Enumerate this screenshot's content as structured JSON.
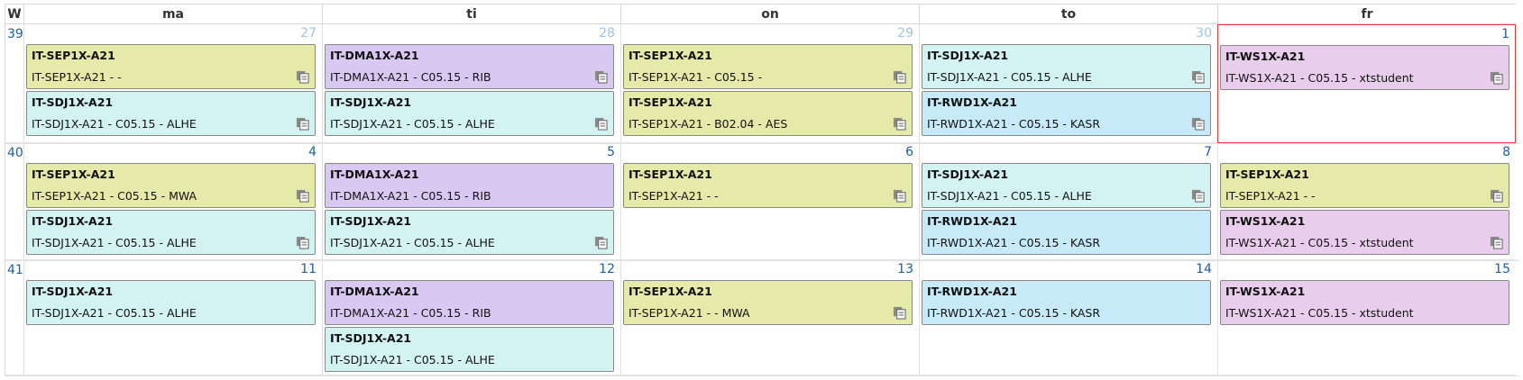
{
  "colors": {
    "SEP": "#e6eaa8",
    "SDJ": "#d3f3f3",
    "DMA": "#d8c8f2",
    "RWD": "#c6eaf8",
    "WS": "#e9cdec",
    "week_text": "#1f5fa0",
    "today_border": "#e8393b"
  },
  "header": {
    "week_label": "W",
    "days": [
      "ma",
      "ti",
      "on",
      "to",
      "fr"
    ]
  },
  "weeks": [
    {
      "number": "39",
      "days": [
        {
          "date": "27",
          "other_month": true,
          "events": [
            {
              "group": "SEP",
              "title": "IT-SEP1X-A21",
              "desc": "IT-SEP1X-A21 - -",
              "icon": true
            },
            {
              "group": "SDJ",
              "title": "IT-SDJ1X-A21",
              "desc": "IT-SDJ1X-A21 - C05.15 - ALHE",
              "icon": true
            }
          ]
        },
        {
          "date": "28",
          "other_month": true,
          "events": [
            {
              "group": "DMA",
              "title": "IT-DMA1X-A21",
              "desc": "IT-DMA1X-A21 - C05.15 - RIB",
              "icon": true
            },
            {
              "group": "SDJ",
              "title": "IT-SDJ1X-A21",
              "desc": "IT-SDJ1X-A21 - C05.15 - ALHE",
              "icon": true
            }
          ]
        },
        {
          "date": "29",
          "other_month": true,
          "events": [
            {
              "group": "SEP",
              "title": "IT-SEP1X-A21",
              "desc": "IT-SEP1X-A21 - C05.15 -",
              "icon": true
            },
            {
              "group": "SEP",
              "title": "IT-SEP1X-A21",
              "desc": "IT-SEP1X-A21 - B02.04 - AES",
              "icon": true
            }
          ]
        },
        {
          "date": "30",
          "other_month": true,
          "events": [
            {
              "group": "SDJ",
              "title": "IT-SDJ1X-A21",
              "desc": "IT-SDJ1X-A21 - C05.15 - ALHE",
              "icon": true
            },
            {
              "group": "RWD",
              "title": "IT-RWD1X-A21",
              "desc": "IT-RWD1X-A21 - C05.15 - KASR",
              "icon": true
            }
          ]
        },
        {
          "date": "1",
          "other_month": false,
          "today": true,
          "events": [
            {
              "group": "WS",
              "title": "IT-WS1X-A21",
              "desc": "IT-WS1X-A21 - C05.15 - xtstudent",
              "icon": true
            }
          ]
        }
      ]
    },
    {
      "number": "40",
      "days": [
        {
          "date": "4",
          "other_month": false,
          "events": [
            {
              "group": "SEP",
              "title": "IT-SEP1X-A21",
              "desc": "IT-SEP1X-A21 - C05.15 - MWA",
              "icon": true
            },
            {
              "group": "SDJ",
              "title": "IT-SDJ1X-A21",
              "desc": "IT-SDJ1X-A21 - C05.15 - ALHE",
              "icon": true
            }
          ]
        },
        {
          "date": "5",
          "other_month": false,
          "events": [
            {
              "group": "DMA",
              "title": "IT-DMA1X-A21",
              "desc": "IT-DMA1X-A21 - C05.15 - RIB",
              "icon": false
            },
            {
              "group": "SDJ",
              "title": "IT-SDJ1X-A21",
              "desc": "IT-SDJ1X-A21 - C05.15 - ALHE",
              "icon": true
            }
          ]
        },
        {
          "date": "6",
          "other_month": false,
          "events": [
            {
              "group": "SEP",
              "title": "IT-SEP1X-A21",
              "desc": "IT-SEP1X-A21 - -",
              "icon": true
            }
          ]
        },
        {
          "date": "7",
          "other_month": false,
          "events": [
            {
              "group": "SDJ",
              "title": "IT-SDJ1X-A21",
              "desc": "IT-SDJ1X-A21 - C05.15 - ALHE",
              "icon": true
            },
            {
              "group": "RWD",
              "title": "IT-RWD1X-A21",
              "desc": "IT-RWD1X-A21 - C05.15 - KASR",
              "icon": false
            }
          ]
        },
        {
          "date": "8",
          "other_month": false,
          "events": [
            {
              "group": "SEP",
              "title": "IT-SEP1X-A21",
              "desc": "IT-SEP1X-A21 - -",
              "icon": true
            },
            {
              "group": "WS",
              "title": "IT-WS1X-A21",
              "desc": "IT-WS1X-A21 - C05.15 - xtstudent",
              "icon": true
            }
          ]
        }
      ]
    },
    {
      "number": "41",
      "days": [
        {
          "date": "11",
          "other_month": false,
          "events": [
            {
              "group": "SDJ",
              "title": "IT-SDJ1X-A21",
              "desc": "IT-SDJ1X-A21 - C05.15 - ALHE",
              "icon": false
            }
          ]
        },
        {
          "date": "12",
          "other_month": false,
          "events": [
            {
              "group": "DMA",
              "title": "IT-DMA1X-A21",
              "desc": "IT-DMA1X-A21 - C05.15 - RIB",
              "icon": false
            },
            {
              "group": "SDJ",
              "title": "IT-SDJ1X-A21",
              "desc": "IT-SDJ1X-A21 - C05.15 - ALHE",
              "icon": false
            }
          ]
        },
        {
          "date": "13",
          "other_month": false,
          "events": [
            {
              "group": "SEP",
              "title": "IT-SEP1X-A21",
              "desc": "IT-SEP1X-A21 - - MWA",
              "icon": true
            }
          ]
        },
        {
          "date": "14",
          "other_month": false,
          "events": [
            {
              "group": "RWD",
              "title": "IT-RWD1X-A21",
              "desc": "IT-RWD1X-A21 - C05.15 - KASR",
              "icon": false
            }
          ]
        },
        {
          "date": "15",
          "other_month": false,
          "events": [
            {
              "group": "WS",
              "title": "IT-WS1X-A21",
              "desc": "IT-WS1X-A21 - C05.15 - xtstudent",
              "icon": false
            }
          ]
        }
      ]
    }
  ]
}
